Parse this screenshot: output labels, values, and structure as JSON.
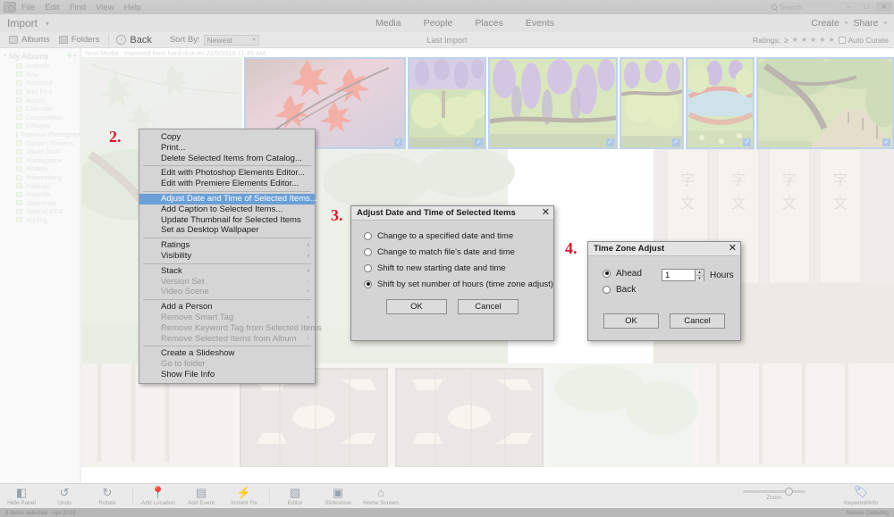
{
  "window": {
    "menus": [
      "File",
      "Edit",
      "Find",
      "View",
      "Help"
    ],
    "search_placeholder": "Search",
    "minimize": "–",
    "maximize": "□",
    "close": "✕"
  },
  "importbar": {
    "label": "Import",
    "caret": "▾"
  },
  "nav": {
    "tabs": [
      "Media",
      "People",
      "Places",
      "Events"
    ]
  },
  "topright": {
    "create": "Create",
    "share": "Share",
    "caret": "▾"
  },
  "toolbar": {
    "albums": "Albums",
    "folders": "Folders",
    "back": "Back",
    "back_glyph": "‹",
    "sort_by_label": "Sort By:",
    "sort_value": "Newest",
    "caret": "▾",
    "center_title": "Last Import",
    "ratings_label": "Ratings:",
    "ratings_op": "≥",
    "star": "★",
    "auto_curate": "Auto Curate"
  },
  "sidebar": {
    "header": "My Albums",
    "tri": "▾",
    "plus": "+",
    "pcaret": "▾",
    "albums": [
      "Animals",
      "Arty",
      "Assorted",
      "Bad Pics",
      "Beach",
      "Calendar",
      "Composition",
      "Ethiopia",
      "Famous Photographers",
      "Garden Flowers",
      "Japan book",
      "Madagascar",
      "Models",
      "Pilanesberg",
      "Portraits",
      "Rwanda",
      "Slideshow",
      "Special EFX",
      "Surfing"
    ]
  },
  "content": {
    "new_media_line": "New Media : Imported from hard disk on 22/5/2019 11:45 AM",
    "check_glyph": "✓"
  },
  "context_menu": {
    "groups": [
      [
        {
          "label": "Copy",
          "state": "normal"
        },
        {
          "label": "Print...",
          "state": "normal"
        },
        {
          "label": "Delete Selected Items from Catalog...",
          "state": "normal"
        }
      ],
      [
        {
          "label": "Edit with Photoshop Elements Editor...",
          "state": "normal"
        },
        {
          "label": "Edit with Premiere Elements Editor...",
          "state": "normal"
        }
      ],
      [
        {
          "label": "Adjust Date and Time of Selected Items...",
          "state": "highlighted"
        },
        {
          "label": "Add Caption to Selected Items...",
          "state": "normal"
        },
        {
          "label": "Update Thumbnail for Selected Items",
          "state": "normal"
        },
        {
          "label": "Set as Desktop Wallpaper",
          "state": "normal"
        }
      ],
      [
        {
          "label": "Ratings",
          "state": "normal",
          "submenu": true
        },
        {
          "label": "Visibility",
          "state": "normal",
          "submenu": true
        }
      ],
      [
        {
          "label": "Stack",
          "state": "normal",
          "submenu": true
        },
        {
          "label": "Version Set",
          "state": "disabled",
          "submenu": true
        },
        {
          "label": "Video Scene",
          "state": "disabled",
          "submenu": true
        }
      ],
      [
        {
          "label": "Add a Person",
          "state": "normal"
        },
        {
          "label": "Remove Smart Tag",
          "state": "disabled",
          "submenu": true
        },
        {
          "label": "Remove Keyword Tag from Selected Items",
          "state": "disabled",
          "submenu": true
        },
        {
          "label": "Remove Selected Items from Album",
          "state": "disabled",
          "submenu": true
        }
      ],
      [
        {
          "label": "Create a Slideshow",
          "state": "normal"
        },
        {
          "label": "Go to folder",
          "state": "disabled"
        },
        {
          "label": "Show File Info",
          "state": "normal"
        }
      ]
    ],
    "submenu_glyph": "›"
  },
  "dialog_adjust": {
    "title": "Adjust Date and Time of Selected Items",
    "close": "✕",
    "options": [
      {
        "label": "Change to a specified date and time",
        "selected": false
      },
      {
        "label": "Change to match file's date and time",
        "selected": false
      },
      {
        "label": "Shift to new starting date and time",
        "selected": false
      },
      {
        "label": "Shift by set number of hours (time zone adjust)",
        "selected": true
      }
    ],
    "ok": "OK",
    "cancel": "Cancel"
  },
  "dialog_timezone": {
    "title": "Time Zone Adjust",
    "close": "✕",
    "options": [
      {
        "label": "Ahead",
        "selected": true
      },
      {
        "label": "Back",
        "selected": false
      }
    ],
    "hours_value": "1",
    "hours_label": "Hours",
    "spin_up": "▴",
    "spin_down": "▾",
    "ok": "OK",
    "cancel": "Cancel"
  },
  "steps": {
    "two": "2.",
    "three": "3.",
    "four": "4."
  },
  "bottombar": {
    "items": [
      {
        "label": "Hide Panel",
        "icon": "panel-icon",
        "glyph": "◧"
      },
      {
        "label": "Undo",
        "icon": "undo-icon",
        "glyph": "↺"
      },
      {
        "label": "Rotate",
        "icon": "rotate-icon",
        "glyph": "↻"
      },
      {
        "label": "Add Location",
        "icon": "location-pin-icon",
        "glyph": "📍"
      },
      {
        "label": "Add Event",
        "icon": "calendar-icon",
        "glyph": "▤"
      },
      {
        "label": "Instant Fix",
        "icon": "bolt-icon",
        "glyph": "⚡"
      },
      {
        "label": "Editor",
        "icon": "editor-icon",
        "glyph": "▧"
      },
      {
        "label": "Slideshow",
        "icon": "slideshow-icon",
        "glyph": "▣"
      },
      {
        "label": "Home Screen",
        "icon": "home-icon",
        "glyph": "⌂"
      }
    ],
    "zoom_label": "Zoom",
    "keyword_info_label": "Keyword/Info",
    "keyword_glyph": "🏷"
  },
  "statusbar": {
    "left": "8 items selected · Apr 2019 ·",
    "right": "Nature Catledog"
  },
  "colors": {
    "accent_blue": "#2f6fc4",
    "selection_blue": "#6a9fd8",
    "annotation_red": "#d8152a",
    "panel_gray": "#d4d4d4"
  }
}
